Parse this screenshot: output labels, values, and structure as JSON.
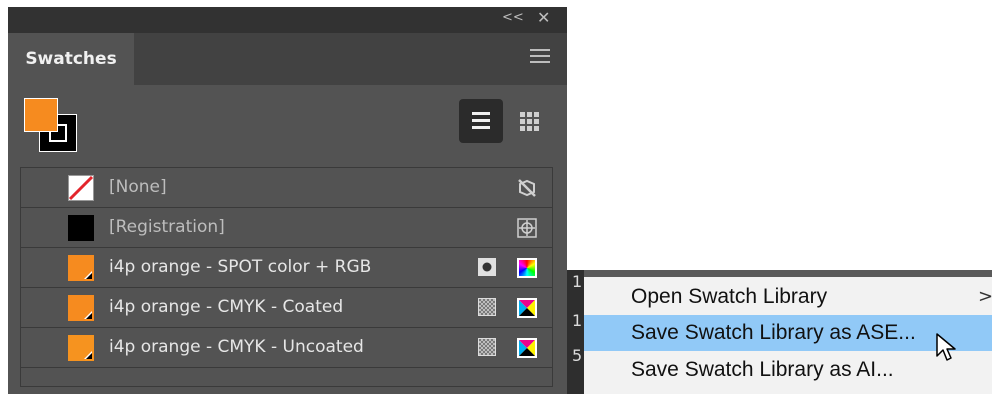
{
  "panel": {
    "collapse_glyph": "<<",
    "close_glyph": "✕",
    "tab_label": "Swatches",
    "fill_color": "#f68b1f",
    "stroke_color": "#000000",
    "views": [
      "list-view",
      "grid-view"
    ]
  },
  "swatches": [
    {
      "name": "[None]",
      "chip": "none",
      "icons": [
        "no-edit-icon"
      ]
    },
    {
      "name": "[Registration]",
      "chip": "#000000",
      "icons": [
        "registration-icon"
      ]
    },
    {
      "name": "i4p orange - SPOT color + RGB",
      "chip": "#f68b1f",
      "icons": [
        "spot-color-icon",
        "rgb-mode-icon"
      ]
    },
    {
      "name": "i4p orange - CMYK - Coated",
      "chip": "#f68b1f",
      "icons": [
        "process-color-icon",
        "cmyk-mode-icon"
      ]
    },
    {
      "name": "i4p orange - CMYK - Uncoated",
      "chip": "#f6931f",
      "icons": [
        "process-color-icon",
        "cmyk-mode-icon"
      ]
    }
  ],
  "menu": {
    "items": [
      {
        "label": "Open Swatch Library",
        "has_submenu": true,
        "submenu_glyph": ">"
      },
      {
        "label": "Save Swatch Library as ASE...",
        "highlighted": true
      },
      {
        "label": "Save Swatch Library as AI..."
      }
    ],
    "highlight_color": "#91c9f7"
  },
  "background_strip": [
    "1",
    "1",
    "5"
  ]
}
